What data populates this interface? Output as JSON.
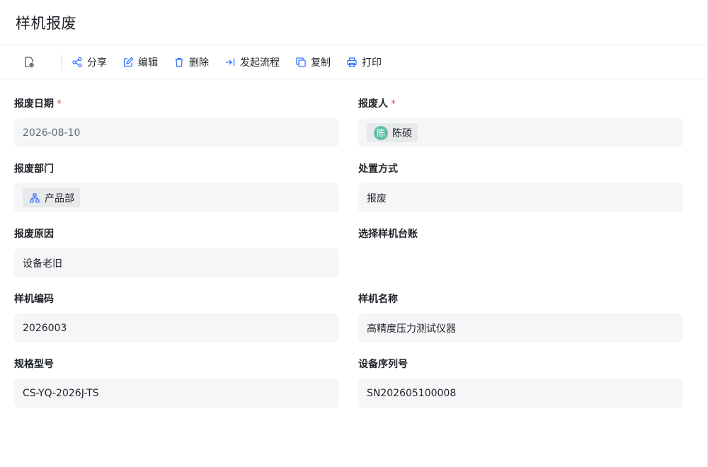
{
  "page": {
    "title": "样机报废"
  },
  "toolbar": {
    "buttons": [
      {
        "id": "share",
        "label": "分享",
        "icon": "share-icon"
      },
      {
        "id": "edit",
        "label": "编辑",
        "icon": "edit-icon"
      },
      {
        "id": "delete",
        "label": "删除",
        "icon": "trash-icon"
      },
      {
        "id": "flow",
        "label": "发起流程",
        "icon": "login-arrow-icon"
      },
      {
        "id": "copy",
        "label": "复制",
        "icon": "copy-icon"
      },
      {
        "id": "print",
        "label": "打印",
        "icon": "printer-icon"
      }
    ]
  },
  "form": {
    "scrap_date": {
      "label": "报废日期",
      "required": "*",
      "value": "2026-08-10"
    },
    "scrap_person": {
      "label": "报废人",
      "required": "*",
      "avatar_char": "陈",
      "value": "陈硕"
    },
    "scrap_dept": {
      "label": "报废部门",
      "value": "产品部"
    },
    "disposal": {
      "label": "处置方式",
      "value": "报废"
    },
    "reason": {
      "label": "报废原因",
      "value": "设备老旧"
    },
    "ledger": {
      "label": "选择样机台账",
      "value": ""
    },
    "code": {
      "label": "样机编码",
      "value": "2026003"
    },
    "name": {
      "label": "样机名称",
      "value": "高精度压力测试仪器"
    },
    "model": {
      "label": "规格型号",
      "value": "CS-YQ-2026J-TS"
    },
    "serial": {
      "label": "设备序列号",
      "value": "SN202605100008"
    }
  },
  "colors": {
    "accent": "#3370ff",
    "required": "#f54a45",
    "field_bg": "#f5f6f7",
    "avatar": "#5fc0a8"
  }
}
